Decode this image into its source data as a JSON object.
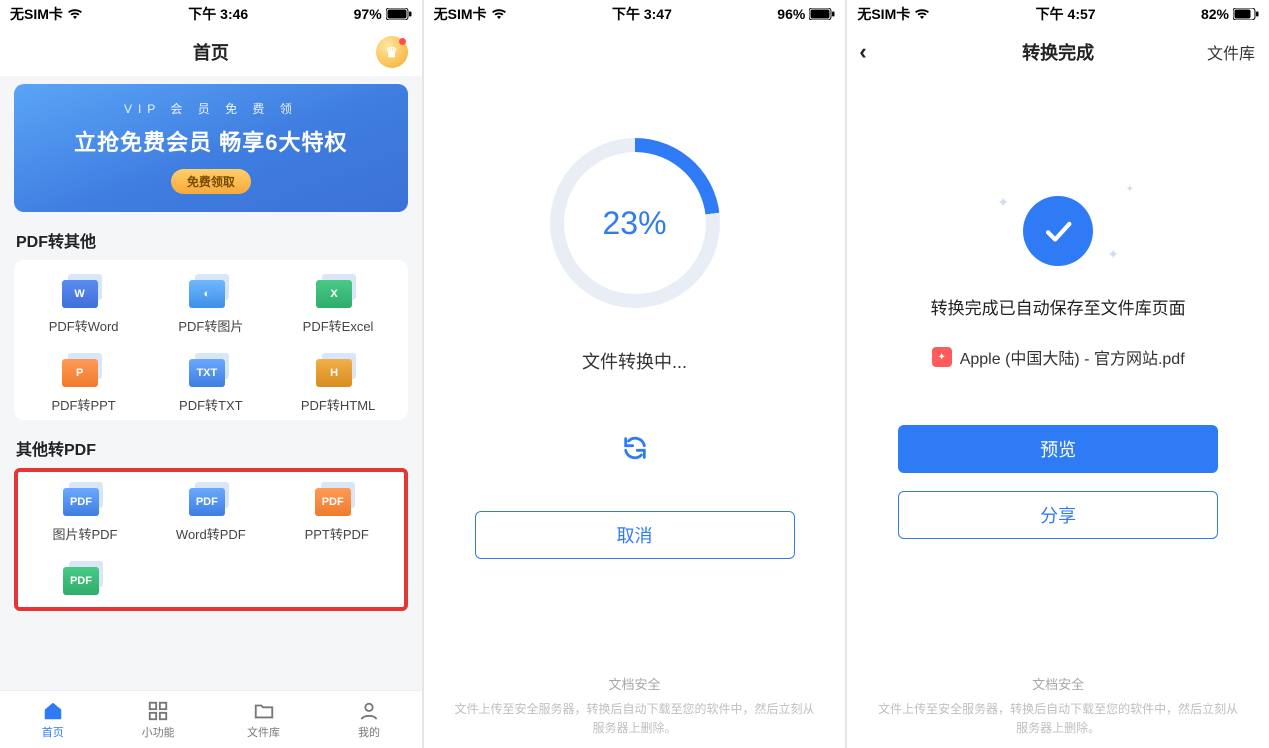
{
  "phone1": {
    "status": {
      "carrier": "无SIM卡",
      "time": "下午 3:46",
      "battery": "97%"
    },
    "nav": {
      "title": "首页"
    },
    "banner": {
      "tag": "VIP 会 员 免 费 领",
      "headline": "立抢免费会员  畅享6大特权",
      "cta": "免费领取"
    },
    "section1_title": "PDF转其他",
    "section1_items": [
      {
        "label": "PDF转Word",
        "badge": "W",
        "cls": "c-blue"
      },
      {
        "label": "PDF转图片",
        "badge": "◐",
        "cls": "c-sky"
      },
      {
        "label": "PDF转Excel",
        "badge": "X",
        "cls": "c-green"
      },
      {
        "label": "PDF转PPT",
        "badge": "P",
        "cls": "c-orange"
      },
      {
        "label": "PDF转TXT",
        "badge": "TXT",
        "cls": "c-txt"
      },
      {
        "label": "PDF转HTML",
        "badge": "H",
        "cls": "c-html"
      }
    ],
    "section2_title": "其他转PDF",
    "section2_items": [
      {
        "label": "图片转PDF",
        "badge": "PDF",
        "cls": "c-pdfblue"
      },
      {
        "label": "Word转PDF",
        "badge": "PDF",
        "cls": "c-pdfblue"
      },
      {
        "label": "PPT转PDF",
        "badge": "PDF",
        "cls": "c-pdforange"
      },
      {
        "label": "",
        "badge": "PDF",
        "cls": "c-pdfgreen"
      }
    ],
    "tabs": [
      {
        "label": "首页"
      },
      {
        "label": "小功能"
      },
      {
        "label": "文件库"
      },
      {
        "label": "我的"
      }
    ]
  },
  "phone2": {
    "status": {
      "carrier": "无SIM卡",
      "time": "下午 3:47",
      "battery": "96%"
    },
    "progress_text": "23%",
    "progress_value": 23,
    "converting_label": "文件转换中...",
    "cancel": "取消",
    "footer_title": "文档安全",
    "footer_body": "文件上传至安全服务器，转换后自动下载至您的软件中，然后立刻从服务器上删除。"
  },
  "phone3": {
    "status": {
      "carrier": "无SIM卡",
      "time": "下午 4:57",
      "battery": "82%"
    },
    "nav": {
      "title": "转换完成",
      "right": "文件库"
    },
    "done_msg": "转换完成已自动保存至文件库页面",
    "file_name": "Apple (中国大陆) - 官方网站.pdf",
    "preview": "预览",
    "share": "分享",
    "footer_title": "文档安全",
    "footer_body": "文件上传至安全服务器，转换后自动下载至您的软件中，然后立刻从服务器上删除。"
  }
}
